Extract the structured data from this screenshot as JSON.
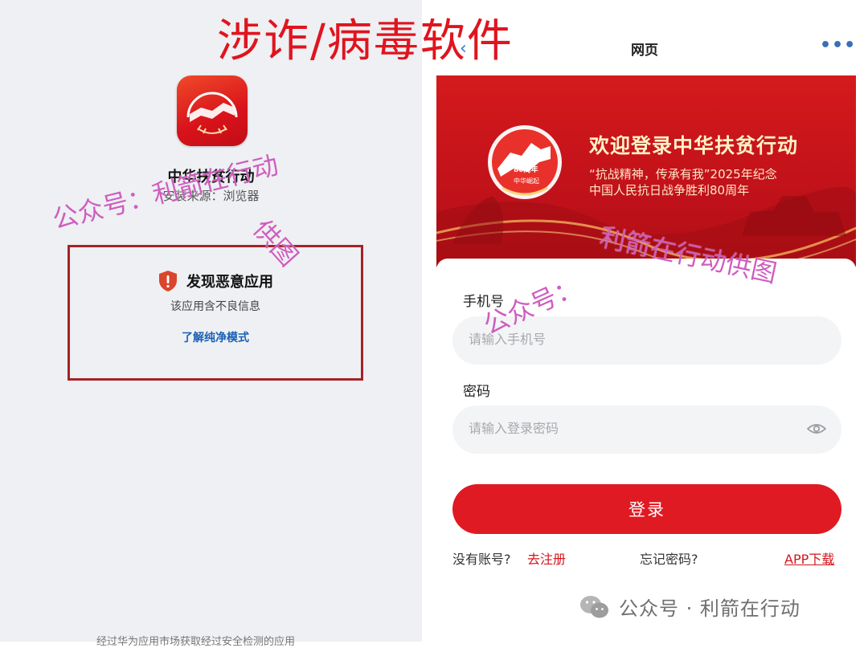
{
  "headline": "涉诈/病毒软件",
  "left": {
    "app_name": "中华扶贫行动",
    "install_source": "安装来源：浏览器",
    "warning": {
      "title": "发现恶意应用",
      "description": "该应用含不良信息",
      "link": "了解纯净模式"
    },
    "bottom_text": "经过华为应用市场获取经过安全检测的应用"
  },
  "right": {
    "page_title": "网页",
    "banner": {
      "title": "欢迎登录中华扶贫行动",
      "subtitle_line1": "“抗战精神，传承有我”2025年纪念",
      "subtitle_line2": "中国人民抗日战争胜利80周年",
      "logo_text_top": "80周年",
      "logo_text_bottom": "中华崛起"
    },
    "phone": {
      "label": "手机号",
      "placeholder": "请输入手机号"
    },
    "password": {
      "label": "密码",
      "placeholder": "请输入登录密码"
    },
    "login_label": "登录",
    "no_account": "没有账号?",
    "register": "去注册",
    "forgot": "忘记密码?",
    "app_download": "APP下载"
  },
  "watermark": {
    "left_a": "公众号：利箭在行动",
    "left_b": "供图",
    "right_a": "公众号：",
    "right_b": "利箭在行动供图"
  },
  "footer": {
    "wechat_account": "公众号 · 利箭在行动"
  },
  "colors": {
    "accent_red": "#e01a22",
    "link_blue": "#1a5fb4",
    "watermark": "#be28aa"
  }
}
